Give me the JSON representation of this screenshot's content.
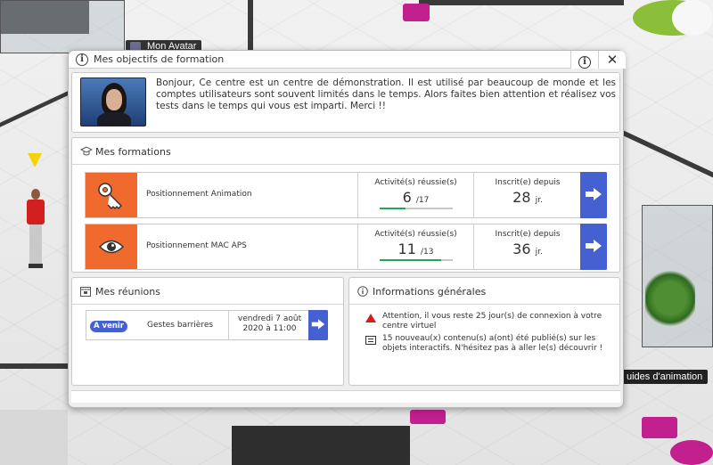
{
  "scene": {
    "avatar_tooltip": "Mon Avatar",
    "animation_tooltip": "uides d'animation"
  },
  "dialog": {
    "title": "Mes objectifs de formation",
    "welcome_text": "Bonjour, Ce centre est un centre de démonstration. Il est utilisé par beaucoup de monde et les comptes utilisateurs sont souvent limités dans le temps. Alors faites bien attention et réalisez vos tests dans le temps qui vous est imparti. Merci !!"
  },
  "formations": {
    "title": "Mes formations",
    "courses": [
      {
        "name": "Positionnement Animation",
        "icon": "key-icon",
        "activities_label": "Activité(s) réussie(s)",
        "done": "6",
        "total": "/17",
        "progress": 0.353,
        "enrolled_label": "Inscrit(e) depuis",
        "days": "28",
        "days_unit": "jr."
      },
      {
        "name": "Positionnement MAC APS",
        "icon": "eye-icon",
        "activities_label": "Activité(s) réussie(s)",
        "done": "11",
        "total": "/13",
        "progress": 0.846,
        "enrolled_label": "Inscrit(e) depuis",
        "days": "36",
        "days_unit": "jr."
      }
    ]
  },
  "reunions": {
    "title": "Mes réunions",
    "meeting": {
      "status": "A venir",
      "name": "Gestes barrières",
      "date_line1": "vendredi 7 août",
      "date_line2": "2020 à 11:00"
    }
  },
  "infos": {
    "title": "Informations générales",
    "warning": "Attention, il vous reste 25 jour(s) de connexion à votre centre virtuel",
    "news": "15 nouveau(x) contenu(s) a(ont) été publié(s) sur les objets interactifs. N'hésitez pas à aller le(s) découvrir !"
  },
  "colors": {
    "tile_orange": "#f06a2e",
    "button_blue": "#4560d0",
    "progress_green": "#27a35a",
    "warning_red": "#d41f1f"
  }
}
